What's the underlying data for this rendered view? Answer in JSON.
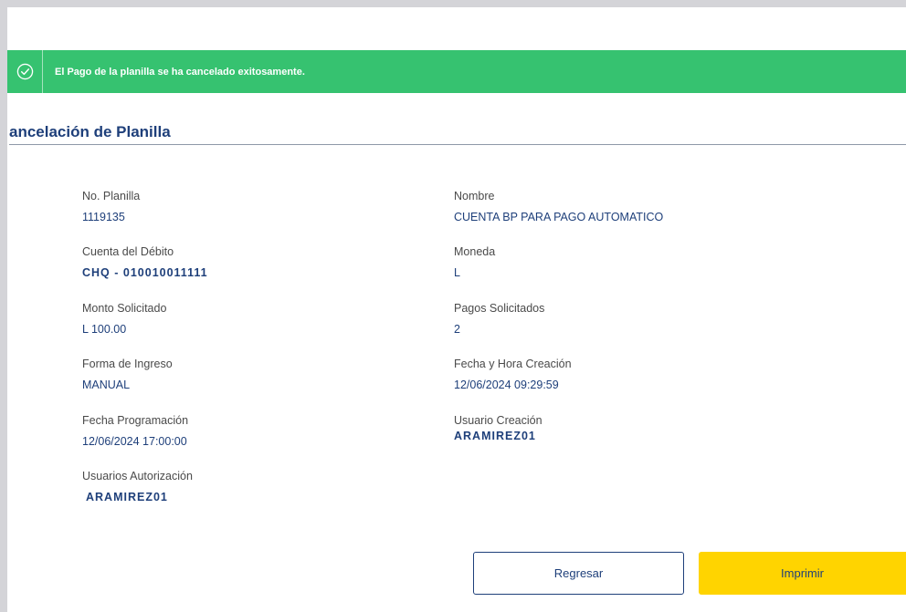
{
  "banner": {
    "message": "El Pago de la planilla se ha cancelado exitosamente.",
    "icon": "check-circle-icon",
    "color": "#36c270"
  },
  "page": {
    "title": "ancelación de Planilla"
  },
  "details": {
    "left": [
      {
        "label": "No. Planilla",
        "value": "1119135"
      },
      {
        "label": "Cuenta del Débito",
        "value": "CHQ - 010010011111"
      },
      {
        "label": "Monto Solicitado",
        "value": "L 100.00"
      },
      {
        "label": "Forma de Ingreso",
        "value": "MANUAL"
      },
      {
        "label": "Fecha Programación",
        "value": "12/06/2024 17:00:00"
      },
      {
        "label": "Usuarios Autorización",
        "value": "ARAMIREZ01"
      }
    ],
    "right": [
      {
        "label": "Nombre",
        "value": "CUENTA BP PARA PAGO AUTOMATICO"
      },
      {
        "label": "Moneda",
        "value": "L"
      },
      {
        "label": "Pagos Solicitados",
        "value": "2"
      },
      {
        "label": "Fecha y Hora Creación",
        "value": "12/06/2024 09:29:59"
      },
      {
        "label": "Usuario Creación",
        "value": "ARAMIREZ01"
      }
    ]
  },
  "actions": {
    "back_label": "Regresar",
    "print_label": "Imprimir",
    "print_color": "#ffd400"
  }
}
